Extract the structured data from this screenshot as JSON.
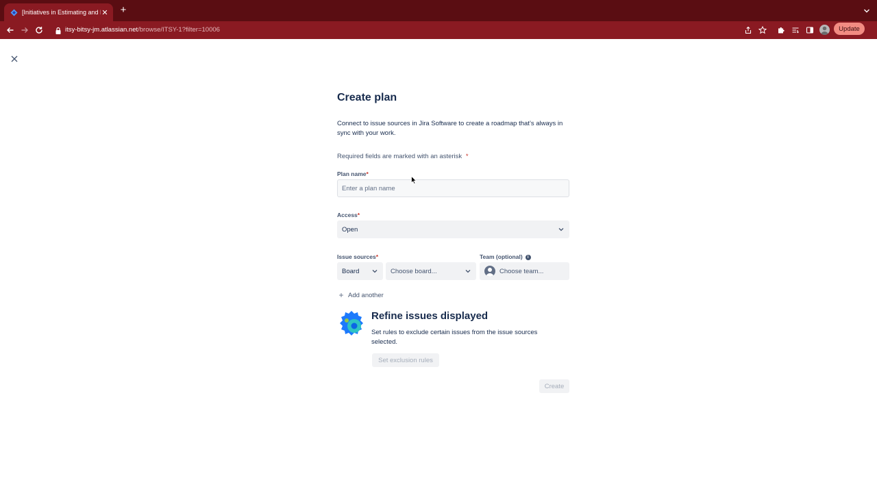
{
  "browser": {
    "tab_title": "[Initiatives in Estimating and Bu",
    "url_host": "itsy-bitsy-jm.atlassian.net",
    "url_path": "/browse/ITSY-1?filter=10006",
    "update_label": "Update"
  },
  "form": {
    "title": "Create plan",
    "description": "Connect to issue sources in Jira Software to create a roadmap that’s always in sync with your work.",
    "required_note": "Required fields are marked with an asterisk",
    "asterisk": "*",
    "plan_name": {
      "label": "Plan name",
      "placeholder": "Enter a plan name",
      "value": ""
    },
    "access": {
      "label": "Access",
      "value": "Open"
    },
    "issue_sources": {
      "label": "Issue sources",
      "type_value": "Board",
      "board_placeholder": "Choose board..."
    },
    "team": {
      "label": "Team (optional)",
      "placeholder": "Choose team..."
    },
    "add_another": "Add another",
    "refine": {
      "title": "Refine issues displayed",
      "description": "Set rules to exclude certain issues from the issue sources selected.",
      "button": "Set exclusion rules"
    },
    "create_button": "Create"
  },
  "colors": {
    "tab_bar": "#5a0d12",
    "toolbar": "#8a1a22",
    "text": "#172b4d",
    "subtle_text": "#44546f",
    "required": "#c9372c",
    "disabled_text": "#a5adba"
  }
}
